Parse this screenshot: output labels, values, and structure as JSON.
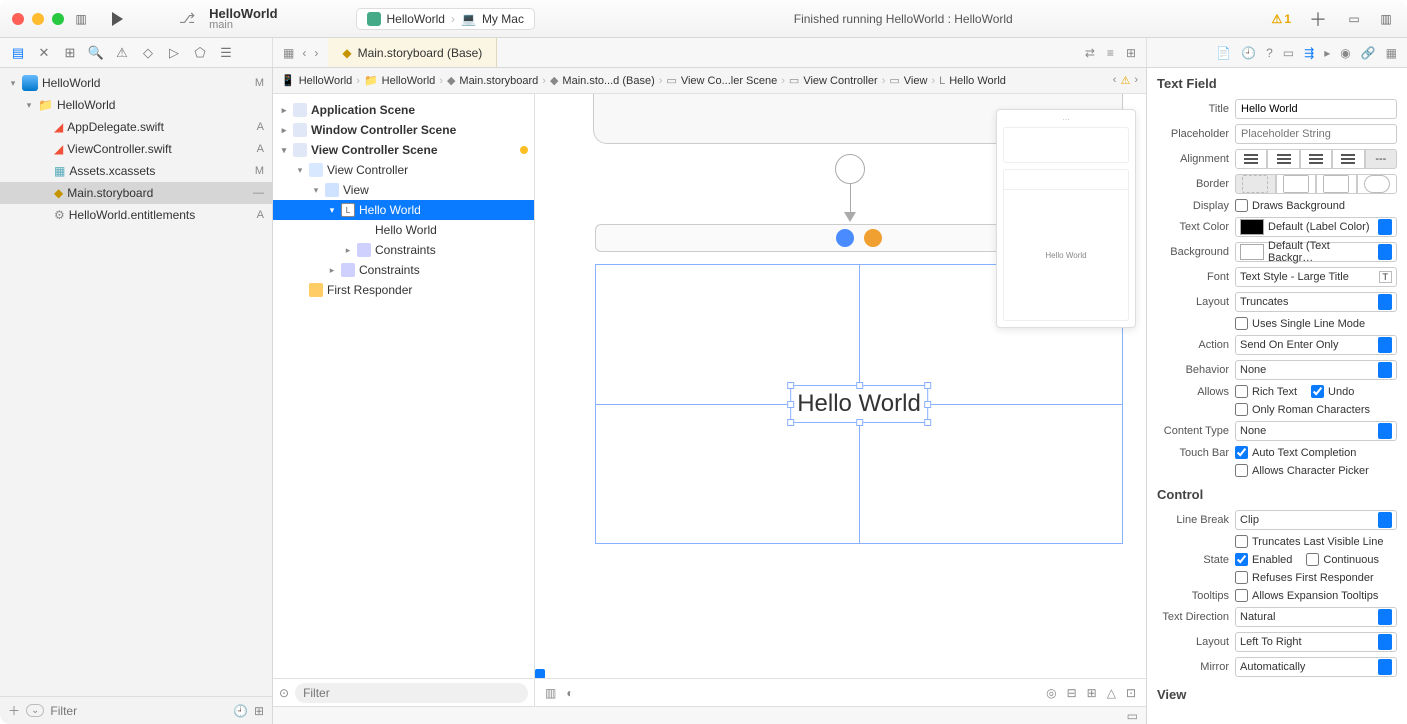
{
  "titlebar": {
    "project_name": "HelloWorld",
    "branch": "main",
    "scheme_app": "HelloWorld",
    "scheme_dest": "My Mac",
    "status": "Finished running HelloWorld : HelloWorld",
    "warning_count": "1"
  },
  "editor_tab": "Main.storyboard (Base)",
  "navigator": {
    "filter_placeholder": "Filter",
    "items": [
      {
        "indent": 0,
        "chev": "▾",
        "icon": "app",
        "name": "HelloWorld",
        "status": "M"
      },
      {
        "indent": 1,
        "chev": "▾",
        "icon": "folder",
        "name": "HelloWorld",
        "status": ""
      },
      {
        "indent": 2,
        "chev": "",
        "icon": "swift",
        "name": "AppDelegate.swift",
        "status": "A"
      },
      {
        "indent": 2,
        "chev": "",
        "icon": "swift",
        "name": "ViewController.swift",
        "status": "A"
      },
      {
        "indent": 2,
        "chev": "",
        "icon": "assets",
        "name": "Assets.xcassets",
        "status": "M"
      },
      {
        "indent": 2,
        "chev": "",
        "icon": "sb",
        "name": "Main.storyboard",
        "status": "—",
        "sel": true
      },
      {
        "indent": 2,
        "chev": "",
        "icon": "ent",
        "name": "HelloWorld.entitlements",
        "status": "A"
      }
    ]
  },
  "breadcrumb": [
    "HelloWorld",
    "HelloWorld",
    "Main.storyboard",
    "Main.sto...d (Base)",
    "View Co...ler Scene",
    "View Controller",
    "View",
    "Hello World"
  ],
  "outline": {
    "filter_placeholder": "Filter",
    "items": [
      {
        "indent": 0,
        "chev": "▸",
        "icon": "scene",
        "name": "Application Scene",
        "hdr": true
      },
      {
        "indent": 0,
        "chev": "▸",
        "icon": "scene",
        "name": "Window Controller Scene",
        "hdr": true
      },
      {
        "indent": 0,
        "chev": "▾",
        "icon": "scene",
        "name": "View Controller Scene",
        "hdr": true,
        "dot": true
      },
      {
        "indent": 1,
        "chev": "▾",
        "icon": "vc",
        "name": "View Controller"
      },
      {
        "indent": 2,
        "chev": "▾",
        "icon": "view",
        "name": "View"
      },
      {
        "indent": 3,
        "chev": "▾",
        "icon": "label",
        "name": "Hello World",
        "sel": true
      },
      {
        "indent": 4,
        "chev": "",
        "icon": "",
        "name": "Hello World"
      },
      {
        "indent": 4,
        "chev": "▸",
        "icon": "constraint",
        "name": "Constraints"
      },
      {
        "indent": 3,
        "chev": "▸",
        "icon": "constraint",
        "name": "Constraints"
      },
      {
        "indent": 1,
        "chev": "",
        "icon": "fr",
        "name": "First Responder"
      }
    ]
  },
  "canvas": {
    "label_text": "Hello World",
    "mini_text": "Hello World"
  },
  "inspector": {
    "sections": {
      "text_field": "Text Field",
      "control": "Control",
      "view": "View"
    },
    "title_label": "Title",
    "title_value": "Hello World",
    "placeholder_label": "Placeholder",
    "placeholder_value": "Placeholder String",
    "alignment_label": "Alignment",
    "border_label": "Border",
    "display_label": "Display",
    "display_value": "Draws Background",
    "text_color_label": "Text Color",
    "text_color_value": "Default (Label Color)",
    "background_label": "Background",
    "background_value": "Default (Text Backgr…",
    "font_label": "Font",
    "font_value": "Text Style - Large Title",
    "layout_label": "Layout",
    "layout_value": "Truncates",
    "single_line": "Uses Single Line Mode",
    "action_label": "Action",
    "action_value": "Send On Enter Only",
    "behavior_label": "Behavior",
    "behavior_value": "None",
    "allows_label": "Allows",
    "rich_text": "Rich Text",
    "undo": "Undo",
    "roman_only": "Only Roman Characters",
    "content_type_label": "Content Type",
    "content_type_value": "None",
    "touch_bar_label": "Touch Bar",
    "auto_completion": "Auto Text Completion",
    "char_picker": "Allows Character Picker",
    "line_break_label": "Line Break",
    "line_break_value": "Clip",
    "trunc_last": "Truncates Last Visible Line",
    "state_label": "State",
    "enabled": "Enabled",
    "continuous": "Continuous",
    "refuses_fr": "Refuses First Responder",
    "tooltips_label": "Tooltips",
    "expansion": "Allows Expansion Tooltips",
    "text_dir_label": "Text Direction",
    "text_dir_value": "Natural",
    "layout2_label": "Layout",
    "layout2_value": "Left To Right",
    "mirror_label": "Mirror",
    "mirror_value": "Automatically"
  }
}
